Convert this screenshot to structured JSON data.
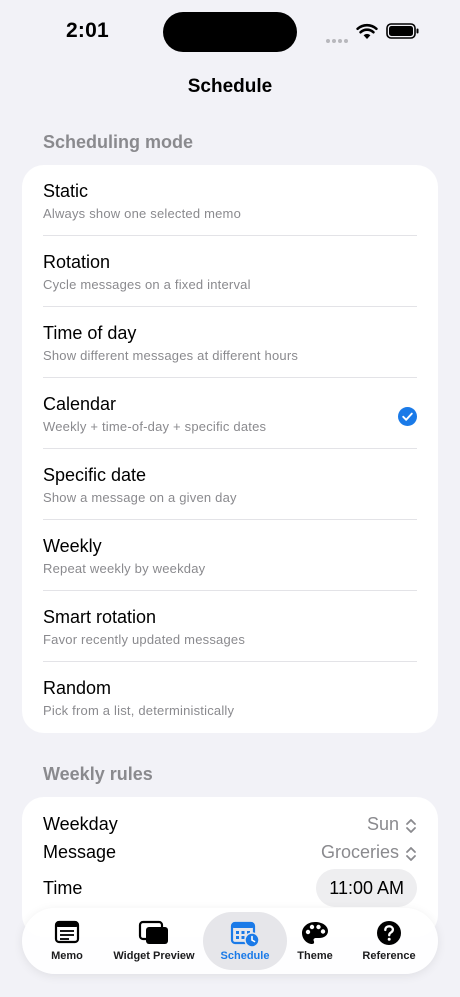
{
  "status": {
    "time": "2:01"
  },
  "nav": {
    "title": "Schedule"
  },
  "scheduling": {
    "header": "Scheduling mode",
    "selected_index": 3,
    "items": [
      {
        "title": "Static",
        "subtitle": "Always show one selected memo"
      },
      {
        "title": "Rotation",
        "subtitle": "Cycle messages on a fixed interval"
      },
      {
        "title": "Time of day",
        "subtitle": "Show different messages at different hours"
      },
      {
        "title": "Calendar",
        "subtitle": "Weekly + time-of-day + specific dates"
      },
      {
        "title": "Specific date",
        "subtitle": "Show a message on a given day"
      },
      {
        "title": "Weekly",
        "subtitle": "Repeat weekly by weekday"
      },
      {
        "title": "Smart rotation",
        "subtitle": "Favor recently updated messages"
      },
      {
        "title": "Random",
        "subtitle": "Pick from a list, deterministically"
      }
    ]
  },
  "weekly_rules": {
    "header": "Weekly rules",
    "weekday_label": "Weekday",
    "weekday_value": "Sun",
    "message_label": "Message",
    "message_value": "Groceries",
    "time_label": "Time",
    "time_value": "11:00 AM"
  },
  "tabbar": {
    "active": "Schedule",
    "tabs": [
      {
        "label": "Memo",
        "icon": "memo-icon"
      },
      {
        "label": "Widget Preview",
        "icon": "widget-preview-icon"
      },
      {
        "label": "Schedule",
        "icon": "calendar-clock-icon"
      },
      {
        "label": "Theme",
        "icon": "palette-icon"
      },
      {
        "label": "Reference",
        "icon": "question-icon"
      }
    ]
  },
  "colors": {
    "accent": "#1a7ae8",
    "background": "#f2f2f7",
    "secondary_text": "#8a8a8e"
  }
}
